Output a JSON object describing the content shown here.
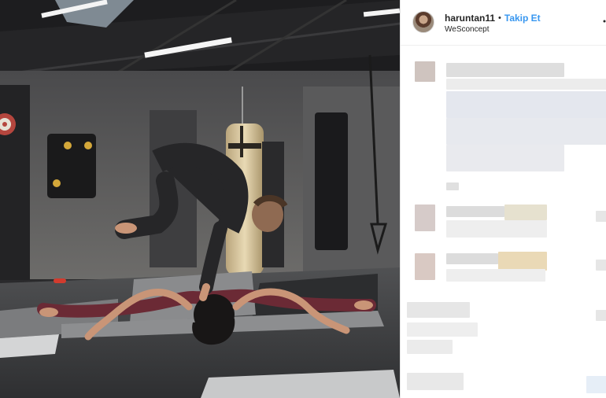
{
  "post": {
    "username": "haruntan11",
    "separator": "•",
    "follow_label": "Takip Et",
    "location": "WeSconcept"
  },
  "icons": {
    "avatar": "profile-photo",
    "more": "more-options-icon"
  },
  "colors": {
    "follow": "#3897f0",
    "text": "#262626",
    "panel_bg": "#ffffff"
  }
}
